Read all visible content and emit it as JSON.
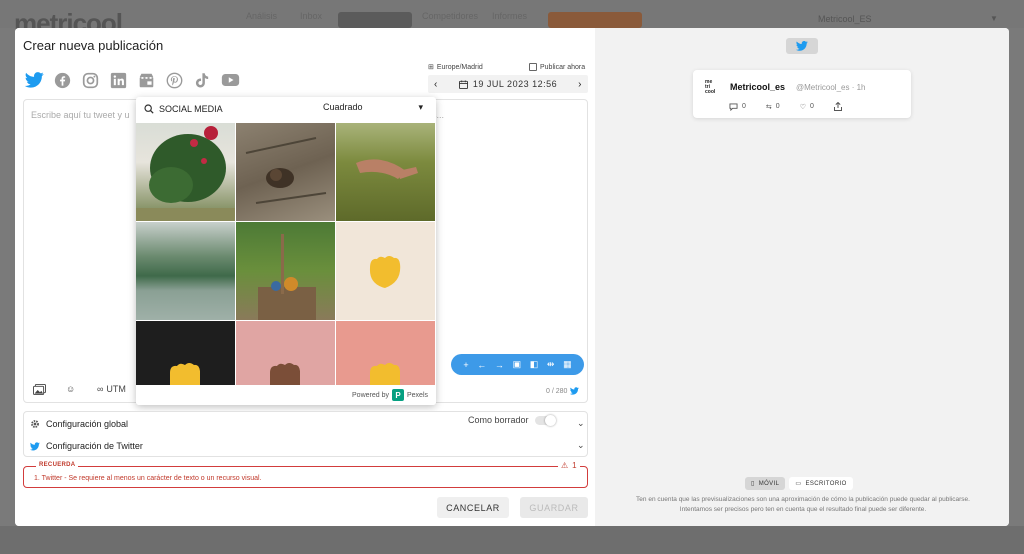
{
  "background": {
    "logo": "metricool",
    "nav": [
      "Análisis",
      "Inbox",
      "Planificación",
      "Competidores",
      "Informes"
    ],
    "cta": "HAZTE PREMIUM",
    "account": "Metricool_ES"
  },
  "modal": {
    "title": "Crear nueva publicación",
    "networks": [
      "twitter-icon",
      "facebook-icon",
      "instagram-icon",
      "linkedin-icon",
      "google-business-icon",
      "pinterest-icon",
      "tiktok-icon",
      "youtube-icon"
    ],
    "timezone": "Europe/Madrid",
    "publish_now": "Publicar ahora",
    "date": "19 JUL 2023 12:56",
    "editor": {
      "placeholder": "Escribe aquí tu tweet y u",
      "placeholder_tail": "s...",
      "utm": "UTM",
      "char_count": "0 / 280"
    },
    "picker": {
      "search_value": "SOCIAL MEDIA",
      "format": "Cuadrado",
      "powered_by": "Powered by",
      "provider": "Pexels"
    },
    "config": {
      "global": "Configuración global",
      "draft": "Como borrador",
      "twitter": "Configuración de Twitter"
    },
    "reminder": {
      "title": "RECUERDA",
      "count": "1",
      "message": "1. Twitter - Se requiere al menos un carácter de texto o un recurso visual."
    },
    "buttons": {
      "cancel": "CANCELAR",
      "save": "GUARDAR"
    }
  },
  "preview": {
    "avatar_lines": [
      "me",
      "tri",
      "cool"
    ],
    "name": "Metricool_es",
    "handle": "@Metricool_es · 1h",
    "replies": "0",
    "retweets": "0",
    "likes": "0",
    "tabs": [
      "MÓVIL",
      "ESCRITORIO"
    ],
    "note_line1": "Ten en cuenta que las previsualizaciones son una aproximación de cómo la publicación puede quedar al publicarse.",
    "note_line2": "Intentamos ser precisos pero ten en cuenta que el resultado final puede ser diferente."
  },
  "colors": {
    "twitter_blue": "#1d9bf0",
    "format_bar": "#3d9ae8",
    "error_red": "#c0392b",
    "pexels_green": "#05a081"
  }
}
